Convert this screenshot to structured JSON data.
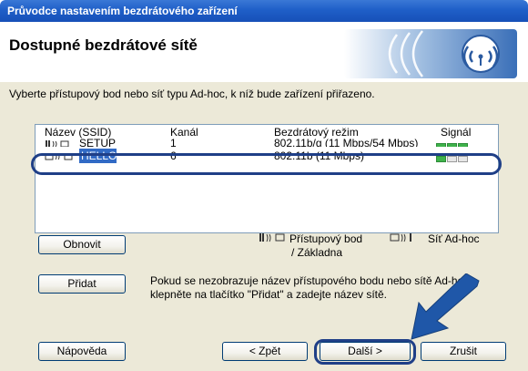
{
  "window": {
    "title": "Průvodce nastavením bezdrátového zařízení",
    "header_title": "Dostupné bezdrátové sítě"
  },
  "instruction": "Vyberte přístupový bod nebo síť typu Ad-hoc, k níž bude zařízení přiřazeno.",
  "list": {
    "columns": [
      "Název (SSID)",
      "Kanál",
      "Bezdrátový režim",
      "Signál"
    ],
    "rows": [
      {
        "ssid": "SETUP",
        "channel": "1",
        "mode": "802.11b/g (11 Mbps/54 Mbps)",
        "signal": 3,
        "icon": "access-point-icon"
      },
      {
        "ssid": "HELLO",
        "channel": "6",
        "mode": "802.11b (11 Mbps)",
        "signal": 1,
        "icon": "adhoc-icon",
        "selected": true
      }
    ]
  },
  "legend": {
    "access_point_line1": "Přístupový bod",
    "access_point_line2": "/ Základna",
    "adhoc": "Síť Ad-hoc"
  },
  "buttons": {
    "refresh": "Obnovit",
    "add": "Přidat",
    "help": "Nápověda",
    "back": "< Zpět",
    "next": "Další >",
    "cancel": "Zrušit"
  },
  "add_hint": "Pokud se nezobrazuje název přístupového bodu nebo sítě Ad-hoc, klepněte na tlačítko \"Přidat\" a zadejte název sítě.",
  "colors": {
    "titlebar": "#1f5fc8",
    "dialog_bg": "#ece9d8",
    "highlight": "#1f3f87",
    "arrow": "#1f57a8",
    "signal_on": "#3fb24b",
    "selection": "#316ac5"
  }
}
